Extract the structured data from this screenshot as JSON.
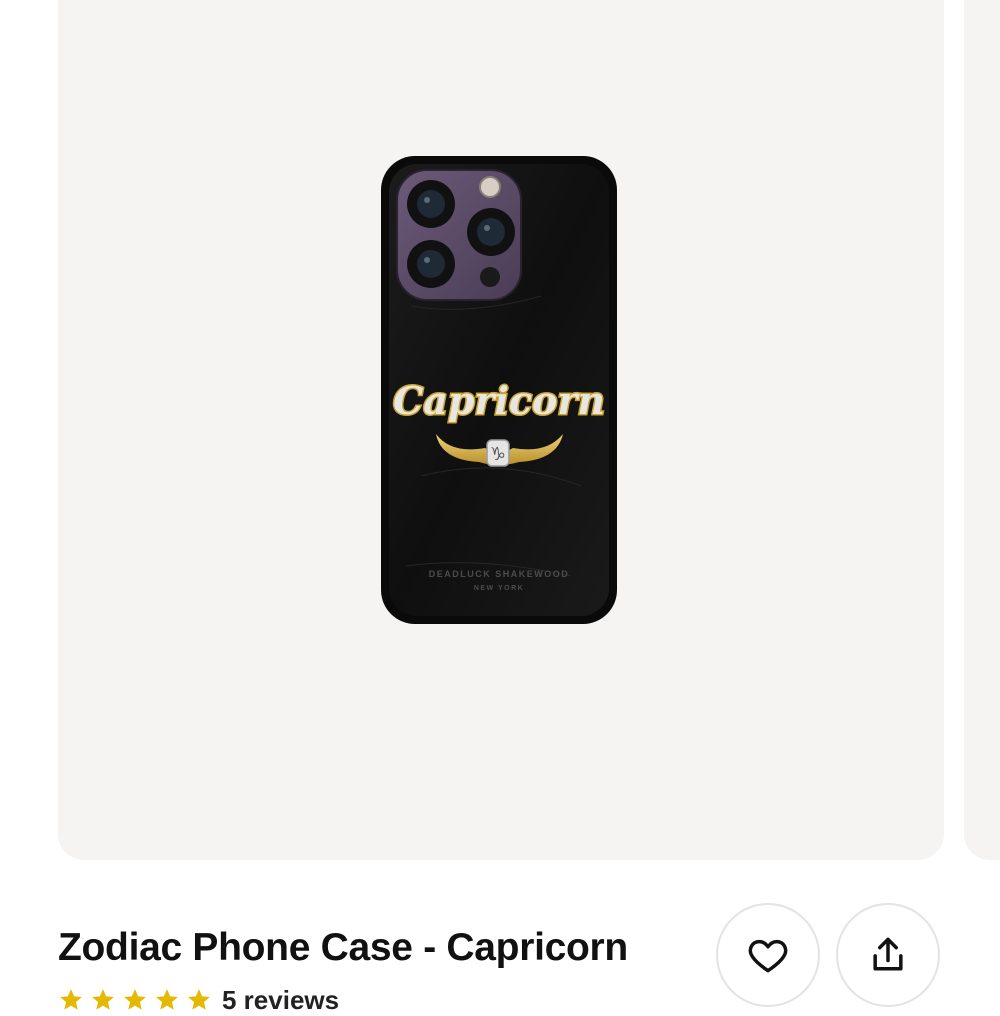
{
  "product": {
    "title": "Zodiac Phone Case - Capricorn",
    "image_alt": "Black leather phone case with Capricorn nameplate",
    "nameplate_text": "Capricorn",
    "case_brand_text": "DEADLUCK SHAKEWOOD",
    "case_city_text": "NEW YORK"
  },
  "rating": {
    "value": 5,
    "max": 5,
    "star_color": "#e6b800",
    "reviews_label": "5 reviews"
  },
  "actions": {
    "favorite_icon": "heart-icon",
    "share_icon": "share-icon"
  },
  "colors": {
    "image_background": "#f5f4f2",
    "case": "#141414",
    "gold": "#c9a227"
  }
}
